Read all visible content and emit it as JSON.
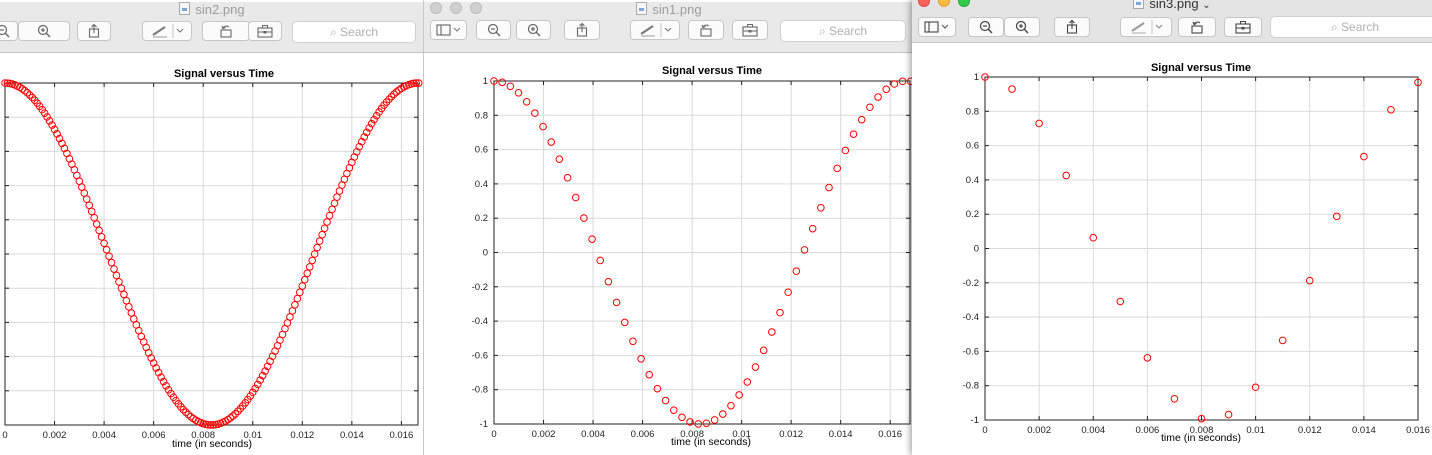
{
  "windows": [
    {
      "id": "sin2",
      "title": "sin2.png",
      "search_placeholder": "Search",
      "chart_data": {
        "type": "scatter",
        "title": "Signal versus Time",
        "xlabel": "time (in seconds)",
        "ylabel": "",
        "xlim": [
          0,
          0.01667
        ],
        "ylim": [
          -1,
          1
        ],
        "xticks": [
          0,
          0.002,
          0.004,
          0.006,
          0.008,
          0.01,
          0.012,
          0.014,
          0.016
        ],
        "xtick_labels": [
          "0",
          "0.002",
          "0.004",
          "0.006",
          "0.008",
          "0.01",
          "0.012",
          "0.014",
          "0.016"
        ],
        "yticks": [
          -1,
          -0.8,
          -0.6,
          -0.4,
          -0.2,
          0,
          0.2,
          0.4,
          0.6,
          0.8,
          1
        ],
        "ytick_labels": [
          "",
          "",
          "",
          "",
          "",
          "",
          "",
          "",
          "",
          "",
          ""
        ],
        "grid": true,
        "marker_color": "#ff0000",
        "signal": {
          "function": "cos",
          "frequency_hz": 60,
          "sample_interval_s": 0.0001,
          "t_start": 0,
          "t_end": 0.0167
        }
      }
    },
    {
      "id": "sin1",
      "title": "sin1.png",
      "search_placeholder": "Search",
      "chart_data": {
        "type": "scatter",
        "title": "Signal versus Time",
        "xlabel": "time (in seconds)",
        "ylabel": "",
        "xlim": [
          0,
          0.0168
        ],
        "ylim": [
          -1,
          1
        ],
        "xticks": [
          0,
          0.002,
          0.004,
          0.006,
          0.008,
          0.01,
          0.012,
          0.014,
          0.016
        ],
        "xtick_labels": [
          "0",
          "0.002",
          "0.004",
          "0.006",
          "0.008",
          "0.01",
          "0.012",
          "0.014",
          "0.016"
        ],
        "yticks": [
          -1,
          -0.8,
          -0.6,
          -0.4,
          -0.2,
          0,
          0.2,
          0.4,
          0.6,
          0.8,
          1
        ],
        "ytick_labels": [
          "-1",
          "-0.8",
          "-0.6",
          "-0.4",
          "-0.2",
          "0",
          "0.2",
          "0.4",
          "0.6",
          "0.8",
          "1"
        ],
        "grid": true,
        "marker_color": "#ff0000",
        "signal": {
          "function": "cos",
          "frequency_hz": 60,
          "sample_interval_s": 0.00033,
          "t_start": 0,
          "t_end": 0.0167
        }
      }
    },
    {
      "id": "sin3",
      "title": "sin3.png",
      "search_placeholder": "Search",
      "chart_data": {
        "type": "scatter",
        "title": "Signal versus Time",
        "xlabel": "time (in seconds)",
        "ylabel": "",
        "xlim": [
          0,
          0.016
        ],
        "ylim": [
          -1,
          1
        ],
        "xticks": [
          0,
          0.002,
          0.004,
          0.006,
          0.008,
          0.01,
          0.012,
          0.014,
          0.016
        ],
        "xtick_labels": [
          "0",
          "0.002",
          "0.004",
          "0.006",
          "0.008",
          "0.01",
          "0.012",
          "0.014",
          "0.016"
        ],
        "yticks": [
          -1,
          -0.8,
          -0.6,
          -0.4,
          -0.2,
          0,
          0.2,
          0.4,
          0.6,
          0.8,
          1
        ],
        "ytick_labels": [
          "-1",
          "-0.8",
          "-0.6",
          "-0.4",
          "-0.2",
          "0",
          "0.2",
          "0.4",
          "0.6",
          "0.8",
          "1"
        ],
        "grid": true,
        "marker_color": "#ff0000",
        "signal": {
          "function": "cos",
          "frequency_hz": 60,
          "sample_interval_s": 0.001,
          "t_start": 0,
          "t_end": 0.016
        }
      }
    }
  ]
}
